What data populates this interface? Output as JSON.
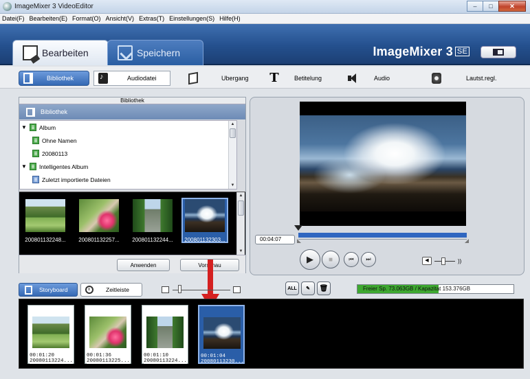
{
  "window": {
    "title": "ImageMixer 3 VideoEditor"
  },
  "menu": [
    "Datei(F)",
    "Bearbeiten(E)",
    "Format(O)",
    "Ansicht(V)",
    "Extras(T)",
    "Einstellungen(S)",
    "Hilfe(H)"
  ],
  "header": {
    "tabs": [
      {
        "label": "Bearbeiten"
      },
      {
        "label": "Speichern"
      }
    ],
    "brand": "ImageMixer 3",
    "brand_edition": "SE"
  },
  "toolbar": [
    {
      "label": "Bibliothek",
      "icon": "library-icon"
    },
    {
      "label": "Audiodatei",
      "icon": "music-note-icon"
    },
    {
      "label": "Ubergang",
      "icon": "transition-icon"
    },
    {
      "label": "Betitelung",
      "icon": "title-T-icon"
    },
    {
      "label": "Audio",
      "icon": "speaker-icon"
    },
    {
      "label": "Lautst.regl.",
      "icon": "gear-icon"
    }
  ],
  "library": {
    "panel_title": "Bibliothek",
    "header": "Bibliothek",
    "tree": [
      {
        "label": "Album"
      },
      {
        "label": "Ohne Namen"
      },
      {
        "label": "20080113"
      },
      {
        "label": "Intelligentes Album"
      },
      {
        "label": "Zuletzt importierte Dateien"
      }
    ],
    "thumbs": [
      {
        "caption": "200801132248..."
      },
      {
        "caption": "200801132257..."
      },
      {
        "caption": "200801132244..."
      },
      {
        "caption": "200801132303..."
      }
    ],
    "apply_button": "Anwenden",
    "preview_button": "Vorschau"
  },
  "preview": {
    "timecode": "00:04:07"
  },
  "storyboard": {
    "tab_storyboard": "Storyboard",
    "tab_timeline": "Zeitleiste",
    "all_button": "ALL",
    "capacity_text": "Freier Sp. 73.063GB / Kapazitat 153.376GB",
    "capacity_used_fraction": 0.52,
    "clips": [
      {
        "duration": "00:01:20",
        "name": "20080113224..."
      },
      {
        "duration": "00:01:36",
        "name": "20080113225..."
      },
      {
        "duration": "00:01:10",
        "name": "20080113224..."
      },
      {
        "duration": "00:01:04",
        "name": "20080113230..."
      }
    ]
  },
  "colors": {
    "accent": "#3569b4",
    "header": "#24508e",
    "drag_arrow": "#d42020",
    "capacity": "#3ea830"
  }
}
